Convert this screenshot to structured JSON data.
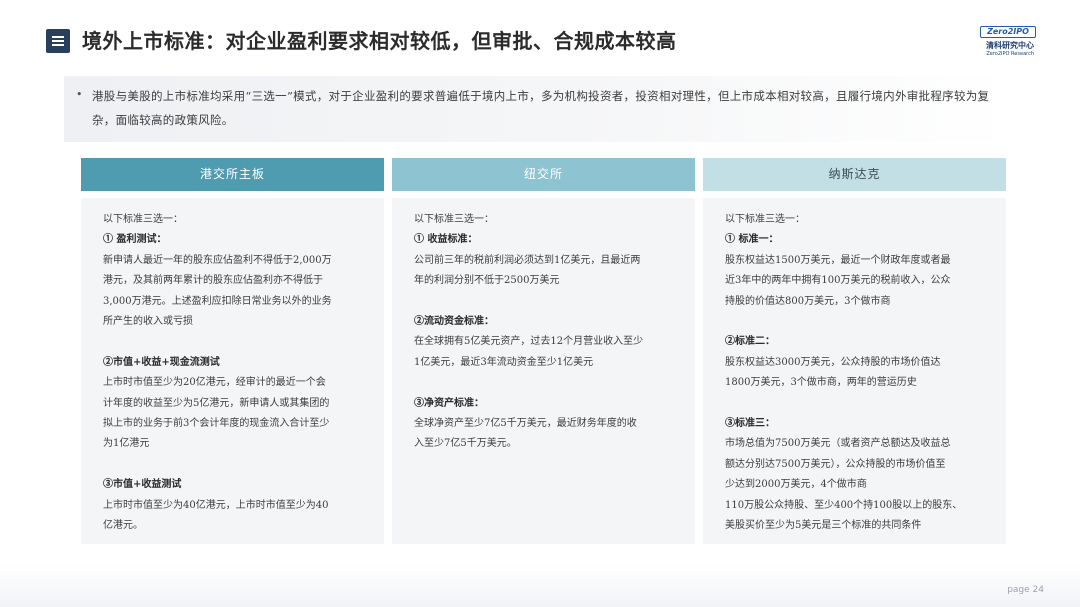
{
  "header": {
    "title": "境外上市标准：对企业盈利要求相对较低，但审批、合规成本较高",
    "logo": {
      "mark": "Zero2IPO",
      "cn": "清科研究中心",
      "en": "Zero2IPO Research"
    }
  },
  "summary": {
    "bullet": "•",
    "text": "港股与美股的上市标准均采用“三选一”模式，对于企业盈利的要求普遍低于境内上市，多为机构投资者，投资相对理性，但上市成本相对较高，且履行境内外审批程序较为复杂，面临较高的政策风险。"
  },
  "columns": [
    {
      "header": "港交所主板",
      "header_bg": "#4f9bb0",
      "header_color": "#ffffff",
      "lines": [
        {
          "t": "以下标准三选一：",
          "k": "text"
        },
        {
          "t": "① 盈利测试：",
          "k": "heading"
        },
        {
          "t": "新申请人最近一年的股东应佔盈利不得低于2,000万",
          "k": "text"
        },
        {
          "t": "港元，及其前两年累计的股东应佔盈利亦不得低于",
          "k": "text"
        },
        {
          "t": "3,000万港元。上述盈利应扣除日常业务以外的业务",
          "k": "text"
        },
        {
          "t": "所产生的收入或亏损",
          "k": "text"
        },
        {
          "t": "",
          "k": "gap"
        },
        {
          "t": "②市值+收益+现金流测试",
          "k": "heading"
        },
        {
          "t": "上市时市值至少为20亿港元，经审计的最近一个会",
          "k": "text"
        },
        {
          "t": "计年度的收益至少为5亿港元，新申请人或其集团的",
          "k": "text"
        },
        {
          "t": "拟上市的业务于前3个会计年度的现金流入合计至少",
          "k": "text"
        },
        {
          "t": "为1亿港元",
          "k": "text"
        },
        {
          "t": "",
          "k": "gap"
        },
        {
          "t": "③市值+收益测试",
          "k": "heading"
        },
        {
          "t": "上市时市值至少为40亿港元，上市时市值至少为40",
          "k": "text"
        },
        {
          "t": "亿港元。",
          "k": "text"
        }
      ]
    },
    {
      "header": "纽交所",
      "header_bg": "#8ec3d1",
      "header_color": "#ffffff",
      "lines": [
        {
          "t": "以下标准三选一：",
          "k": "text"
        },
        {
          "t": "① 收益标准：",
          "k": "heading"
        },
        {
          "t": "公司前三年的税前利润必须达到1亿美元，且最近两",
          "k": "text"
        },
        {
          "t": "年的利润分别不低于2500万美元",
          "k": "text"
        },
        {
          "t": "",
          "k": "gap"
        },
        {
          "t": "②流动资金标准：",
          "k": "heading"
        },
        {
          "t": "在全球拥有5亿美元资产，过去12个月营业收入至少",
          "k": "text"
        },
        {
          "t": "1亿美元，最近3年流动资金至少1亿美元",
          "k": "text"
        },
        {
          "t": "",
          "k": "gap"
        },
        {
          "t": "③净资产标准：",
          "k": "heading"
        },
        {
          "t": "全球净资产至少7亿5千万美元，最近财务年度的收",
          "k": "text"
        },
        {
          "t": "入至少7亿5千万美元。",
          "k": "text"
        }
      ]
    },
    {
      "header": "纳斯达克",
      "header_bg": "#c2dfe6",
      "header_color": "#3c4a52",
      "lines": [
        {
          "t": "以下标准三选一：",
          "k": "text"
        },
        {
          "t": "① 标准一：",
          "k": "heading"
        },
        {
          "t": "股东权益达1500万美元，最近一个财政年度或者最",
          "k": "text"
        },
        {
          "t": "近3年中的两年中拥有100万美元的税前收入，公众",
          "k": "text"
        },
        {
          "t": "持股的价值达800万美元，3个做市商",
          "k": "text"
        },
        {
          "t": "",
          "k": "gap"
        },
        {
          "t": "②标准二：",
          "k": "heading"
        },
        {
          "t": "股东权益达3000万美元，公众持股的市场价值达",
          "k": "text"
        },
        {
          "t": "1800万美元，3个做市商，两年的营运历史",
          "k": "text"
        },
        {
          "t": "",
          "k": "gap"
        },
        {
          "t": "③标准三：",
          "k": "heading"
        },
        {
          "t": "市场总值为7500万美元（或者资产总额达及收益总",
          "k": "text"
        },
        {
          "t": "额达分别达7500万美元），公众持股的市场价值至",
          "k": "text"
        },
        {
          "t": "少达到2000万美元，4个做市商",
          "k": "text"
        },
        {
          "t": "110万股公众持股、至少400个持100股以上的股东、",
          "k": "text"
        },
        {
          "t": "美股买价至少为5美元是三个标准的共同条件",
          "k": "text"
        }
      ]
    }
  ],
  "footer": {
    "page": "page  24"
  }
}
